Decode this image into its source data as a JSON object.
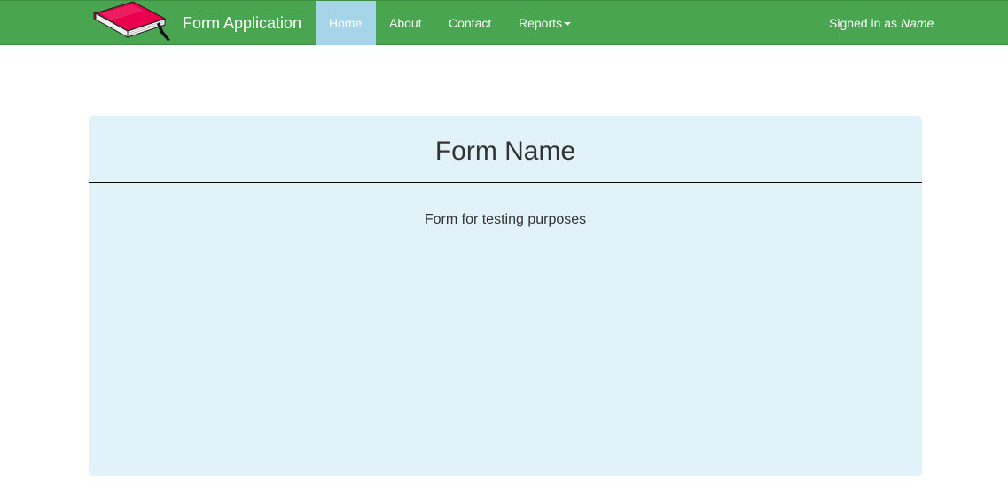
{
  "navbar": {
    "brand": "Form Application",
    "logo_icon": "book-icon",
    "items": [
      {
        "label": "Home",
        "active": true
      },
      {
        "label": "About",
        "active": false
      },
      {
        "label": "Contact",
        "active": false
      },
      {
        "label": "Reports",
        "active": false,
        "dropdown": true
      }
    ],
    "signed_in_prefix": "Signed in as",
    "signed_in_user": "Name"
  },
  "panel": {
    "title": "Form Name",
    "description": "Form for testing purposes"
  },
  "colors": {
    "navbar_bg": "#49a550",
    "active_tab_bg": "#a6d5ea",
    "panel_bg": "#e2f2f9",
    "book_cover": "#e8004e"
  }
}
